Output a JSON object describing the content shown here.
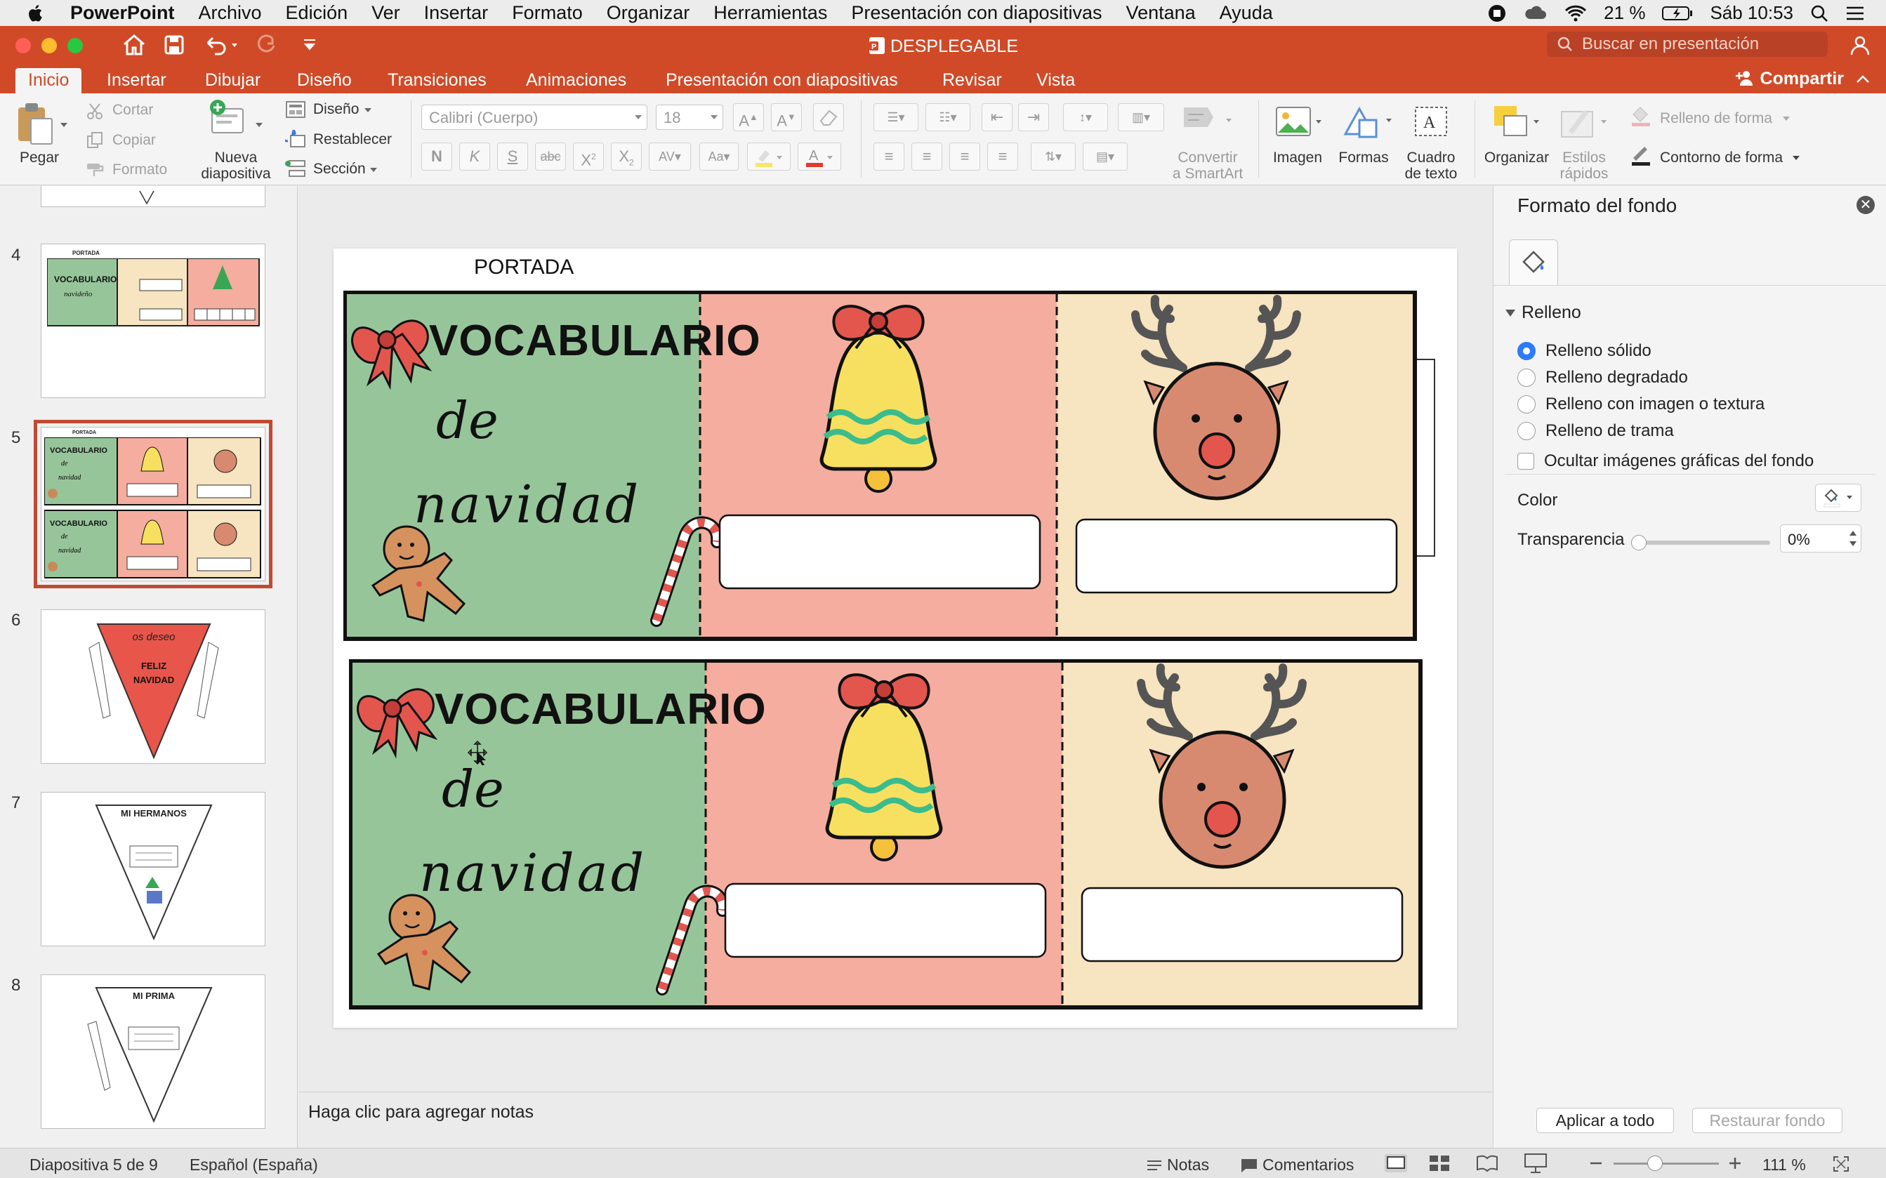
{
  "menubar": {
    "app": "PowerPoint",
    "items": [
      "Archivo",
      "Edición",
      "Ver",
      "Insertar",
      "Formato",
      "Organizar",
      "Herramientas",
      "Presentación con diapositivas",
      "Ventana",
      "Ayuda"
    ],
    "battery": "21 %",
    "clock": "Sáb 10:53"
  },
  "window": {
    "title": "DESPLEGABLE",
    "search_placeholder": "Buscar en presentación"
  },
  "ribbon_tabs": [
    "Inicio",
    "Insertar",
    "Dibujar",
    "Diseño",
    "Transiciones",
    "Animaciones",
    "Presentación con diapositivas",
    "Revisar",
    "Vista"
  ],
  "share_label": "Compartir",
  "ribbon": {
    "paste": "Pegar",
    "cut": "Cortar",
    "copy": "Copiar",
    "format": "Formato",
    "new_slide_1": "Nueva",
    "new_slide_2": "diapositiva",
    "layout": "Diseño",
    "reset": "Restablecer",
    "section": "Sección",
    "font_name": "Calibri (Cuerpo)",
    "font_size": "18",
    "convert_1": "Convertir",
    "convert_2": "a SmartArt",
    "image": "Imagen",
    "shapes": "Formas",
    "textbox_1": "Cuadro",
    "textbox_2": "de texto",
    "arrange": "Organizar",
    "quickstyles_1": "Estilos",
    "quickstyles_2": "rápidos",
    "shape_fill": "Relleno de forma",
    "shape_outline": "Contorno de forma"
  },
  "slides": [
    {
      "number": "4",
      "label": "PORTADA"
    },
    {
      "number": "5",
      "label": "PORTADA"
    },
    {
      "number": "6",
      "text": "os deseo",
      "text2": "FELIZ NAVIDAD"
    },
    {
      "number": "7",
      "text": "MI HERMANOS"
    },
    {
      "number": "8",
      "text": "MI PRIMA"
    }
  ],
  "slide_main": {
    "title": "PORTADA",
    "vocab": "VOCABULARIO",
    "de": "de",
    "navidad": "navidad"
  },
  "notes_placeholder": "Haga clic para agregar notas",
  "format_pane": {
    "title": "Formato del fondo",
    "section": "Relleno",
    "options": [
      "Relleno sólido",
      "Relleno degradado",
      "Relleno con imagen o textura",
      "Relleno de trama"
    ],
    "selected_option": "Relleno sólido",
    "hide_graphics": "Ocultar imágenes gráficas del fondo",
    "color_label": "Color",
    "transparency_label": "Transparencia",
    "transparency_value": "0%",
    "apply_all": "Aplicar a todo",
    "reset_bg": "Restaurar fondo"
  },
  "status": {
    "slide_counter": "Diapositiva 5 de 9",
    "language": "Español (España)",
    "notes": "Notas",
    "comments": "Comentarios",
    "zoom": "111 %"
  },
  "colors": {
    "accent": "#d04a28",
    "green_panel": "#97c59a",
    "salmon_panel": "#f4ad9e",
    "cream_panel": "#f7e4c0",
    "selected_radio": "#2d7cf6"
  }
}
